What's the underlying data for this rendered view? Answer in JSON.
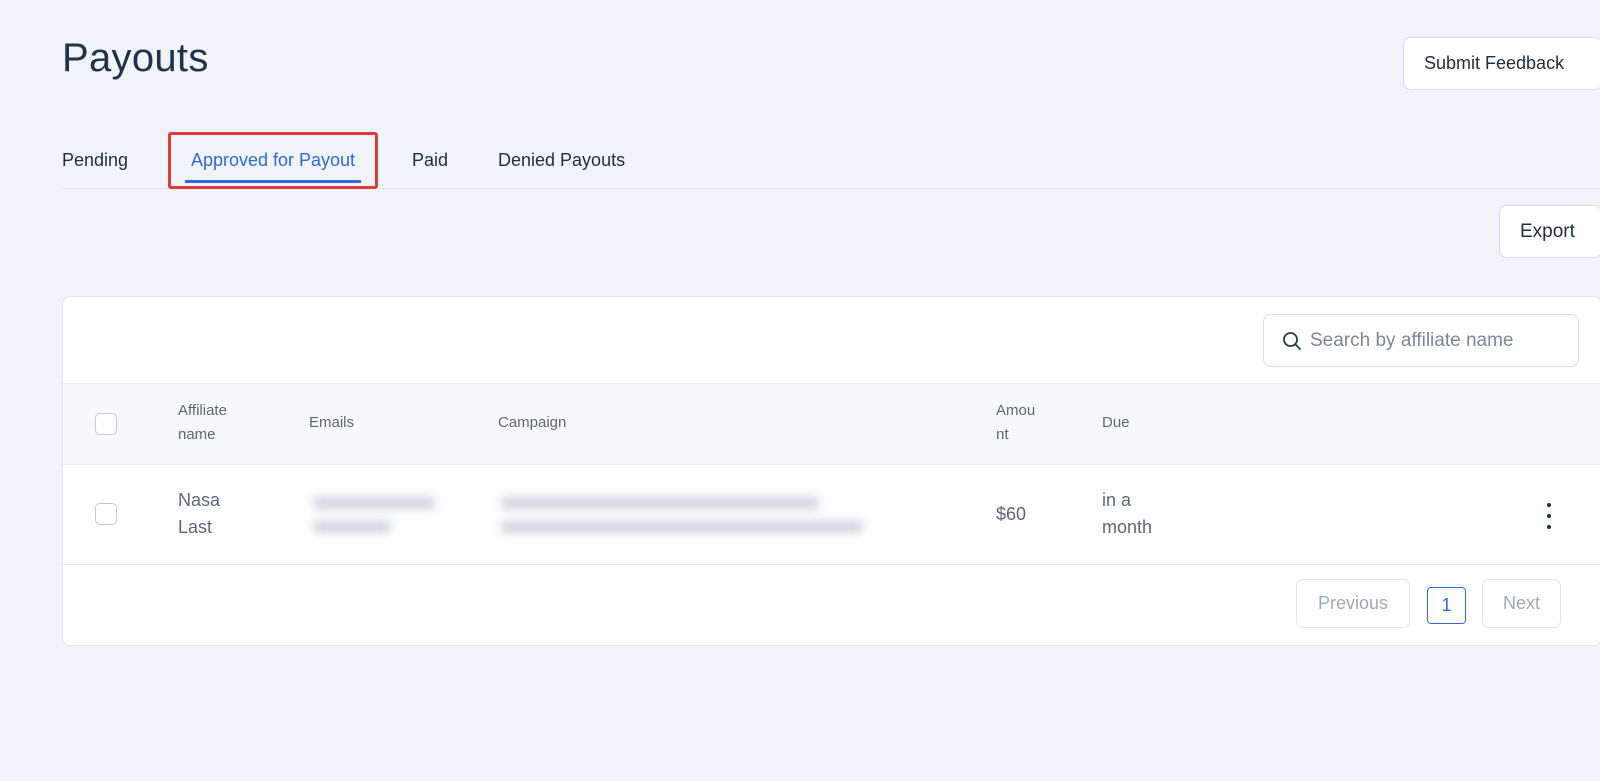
{
  "header": {
    "title": "Payouts",
    "submit_feedback_label": "Submit Feedback"
  },
  "tabs": [
    {
      "label": "Pending",
      "active": false
    },
    {
      "label": "Approved for Payout",
      "active": true
    },
    {
      "label": "Paid",
      "active": false
    },
    {
      "label": "Denied Payouts",
      "active": false
    }
  ],
  "toolbar": {
    "export_label": "Export"
  },
  "search": {
    "placeholder": "Search by affiliate name"
  },
  "table": {
    "columns": {
      "affiliate_name": "Affiliate name",
      "emails": "Emails",
      "campaign": "Campaign",
      "amount": "Amount",
      "due": "Due"
    },
    "rows": [
      {
        "affiliate_name": "Nasa Last",
        "email": "",
        "campaign": "",
        "amount": "$60",
        "due": "in a month"
      }
    ]
  },
  "pagination": {
    "previous_label": "Previous",
    "current_page": "1",
    "next_label": "Next"
  },
  "colors": {
    "accent": "#2f6ad9",
    "highlight_border": "#e03a3a",
    "background": "#f0f3f7"
  }
}
